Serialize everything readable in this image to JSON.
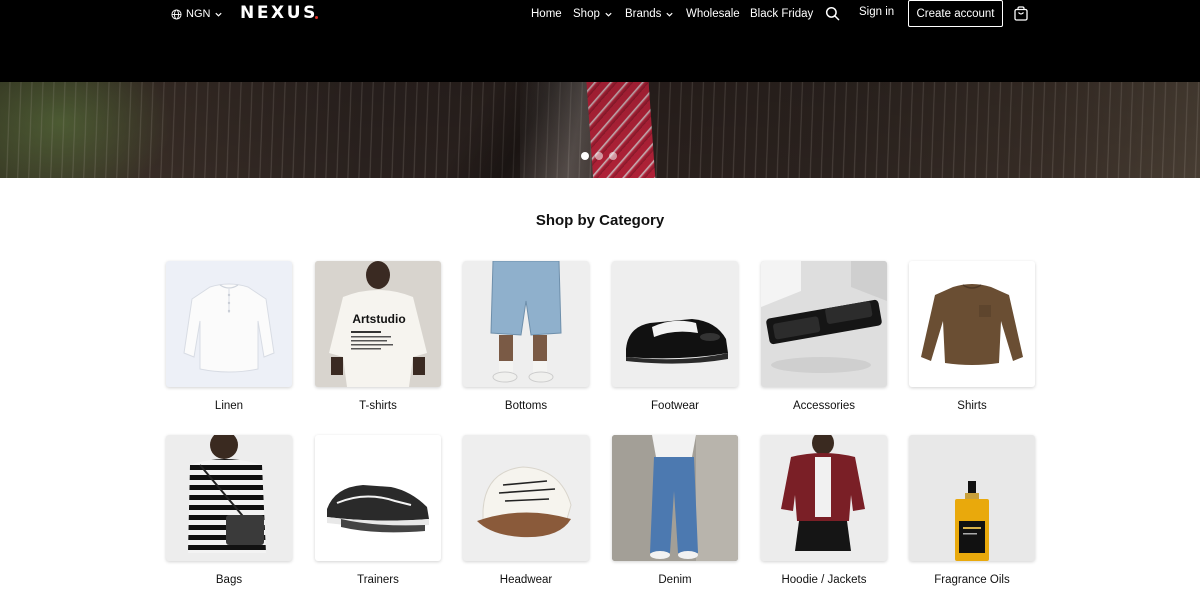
{
  "header": {
    "currency": "NGN",
    "logo": "NEXUS",
    "nav": [
      {
        "label": "Home"
      },
      {
        "label": "Shop"
      },
      {
        "label": "Brands"
      },
      {
        "label": "Wholesale"
      },
      {
        "label": "Black Friday"
      }
    ],
    "sign_in": "Sign in",
    "create_account": "Create account"
  },
  "hero": {
    "slides_total": 3,
    "active_slide": 1
  },
  "categories": {
    "title": "Shop by Category",
    "items": [
      {
        "label": "Linen"
      },
      {
        "label": "T-shirts",
        "print": "Artstudio"
      },
      {
        "label": "Bottoms"
      },
      {
        "label": "Footwear"
      },
      {
        "label": "Accessories"
      },
      {
        "label": "Shirts"
      },
      {
        "label": "Bags"
      },
      {
        "label": "Trainers"
      },
      {
        "label": "Headwear"
      },
      {
        "label": "Denim"
      },
      {
        "label": "Hoodie / Jackets"
      },
      {
        "label": "Fragrance Oils"
      }
    ]
  },
  "colors": {
    "header_bg": "#000000",
    "logo_dot": "#e1342b",
    "text": "#111111"
  }
}
